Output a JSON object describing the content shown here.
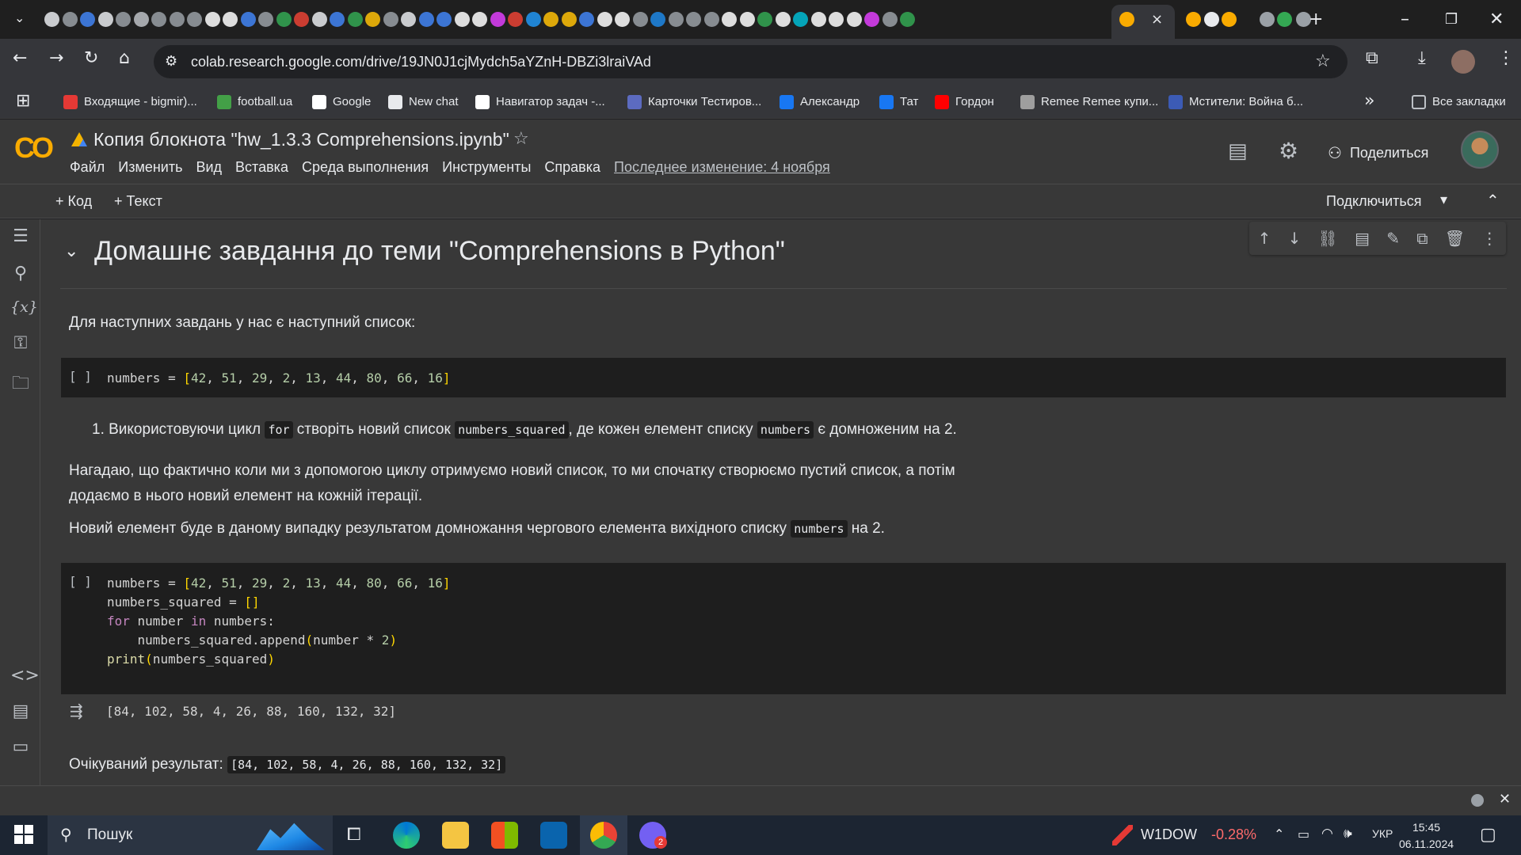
{
  "browser": {
    "url": "colab.research.google.com/drive/19JN0J1cjMydch5aYZnH-DBZi3lraiVAd",
    "bookmarks": [
      {
        "label": "Входящие - bigmir)...",
        "color": "#e53935"
      },
      {
        "label": "football.ua",
        "color": "#43a047"
      },
      {
        "label": "Google",
        "color": "#ffffff"
      },
      {
        "label": "New chat",
        "color": "#e8eaed"
      },
      {
        "label": "Навигатор задач -...",
        "color": "#ffffff"
      },
      {
        "label": "Карточки Тестиров...",
        "color": "#5c6bc0"
      },
      {
        "label": "Александр",
        "color": "#1877f2"
      },
      {
        "label": "Тат",
        "color": "#1877f2"
      },
      {
        "label": "Гордон",
        "color": "#ff0000"
      },
      {
        "label": "Remee Remee купи...",
        "color": "#9e9e9e"
      },
      {
        "label": "Мстители: Война б...",
        "color": "#3c5bb5"
      }
    ],
    "all_bookmarks_label": "Все закладки"
  },
  "colab": {
    "logo": "CO",
    "title": "Копия блокнота \"hw_1.3.3 Comprehensions.ipynb\"",
    "menu": [
      "Файл",
      "Изменить",
      "Вид",
      "Вставка",
      "Среда выполнения",
      "Инструменты",
      "Справка"
    ],
    "last_edit": "Последнее изменение: 4 ноября",
    "share_label": "Поделиться",
    "add_code": "+ Код",
    "add_text": "+ Текст",
    "connect_label": "Подключиться"
  },
  "notebook": {
    "heading": "Домашнє завдання до теми \"Comprehensions в Python\"",
    "intro": "Для наступних завдань у нас є наступний список:",
    "cell1_bracket": "[ ]",
    "task1": {
      "prefix": "1. Використовуючи цикл ",
      "code1": "for",
      "mid1": " створіть новий список ",
      "code2": "numbers_squared",
      "mid2": ", де кожен елемент списку ",
      "code3": "numbers",
      "suffix": " є домноженим на 2."
    },
    "note1_line1": "Нагадаю, що фактично коли ми з допомогою циклу отримуємо новий список, то ми спочатку створюємо пустий список, а потім",
    "note1_line2": "додаємо в нього новий елемент на кожній ітерації.",
    "note2_prefix": "Новий елемент буде в даному випадку результатом домножання чергового елемента вихідного списку ",
    "note2_code": "numbers",
    "note2_suffix": " на 2.",
    "cell2_bracket": "[ ]",
    "output": "[84, 102, 58, 4, 26, 88, 160, 132, 32]",
    "expected_label": "Очікуваний результат: ",
    "expected_value": "[84, 102, 58, 4, 26, 88, 160, 132, 32]"
  },
  "taskbar": {
    "search": "Пошук",
    "stock_name": "W1DOW",
    "stock_change": "-0.28%",
    "lang": "УКР",
    "time": "15:45",
    "date": "06.11.2024",
    "badge": "2"
  }
}
